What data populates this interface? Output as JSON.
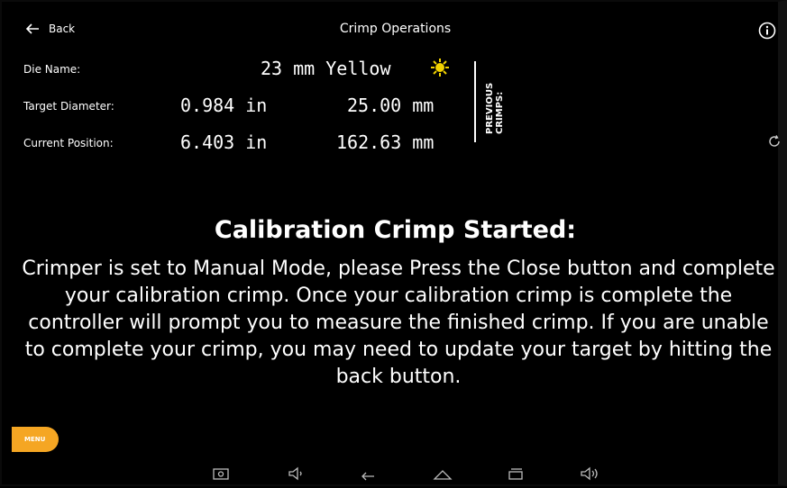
{
  "header": {
    "back_label": "Back",
    "title": "Crimp Operations"
  },
  "rows": {
    "die_name": {
      "label": "Die Name:",
      "value": "23 mm Yellow"
    },
    "target_diameter": {
      "label": "Target Diameter:",
      "inches": "0.984 in",
      "mm": "25.00 mm"
    },
    "current_position": {
      "label": "Current Position:",
      "inches": "6.403 in",
      "mm": "162.63 mm"
    }
  },
  "previous_crimps_label": "PREVIOUS CRIMPS:",
  "message": {
    "title": "Calibration Crimp Started:",
    "body": "Crimper is set to Manual Mode, please Press the Close button and complete your calibration crimp. Once your calibration crimp is complete the controller will prompt you to measure the finished crimp. If you are unable to complete your crimp, you may need to update your target by hitting the back button."
  },
  "menu_label": "MENU",
  "colors": {
    "accent": "#f5a623",
    "die_yellow": "#f2d200",
    "background": "#000000"
  },
  "icons": [
    "back-arrow-icon",
    "info-icon",
    "die-color-icon",
    "refresh-icon",
    "screenshot-icon",
    "volume-down-icon",
    "nav-back-icon",
    "home-icon",
    "recents-icon",
    "volume-up-icon"
  ]
}
